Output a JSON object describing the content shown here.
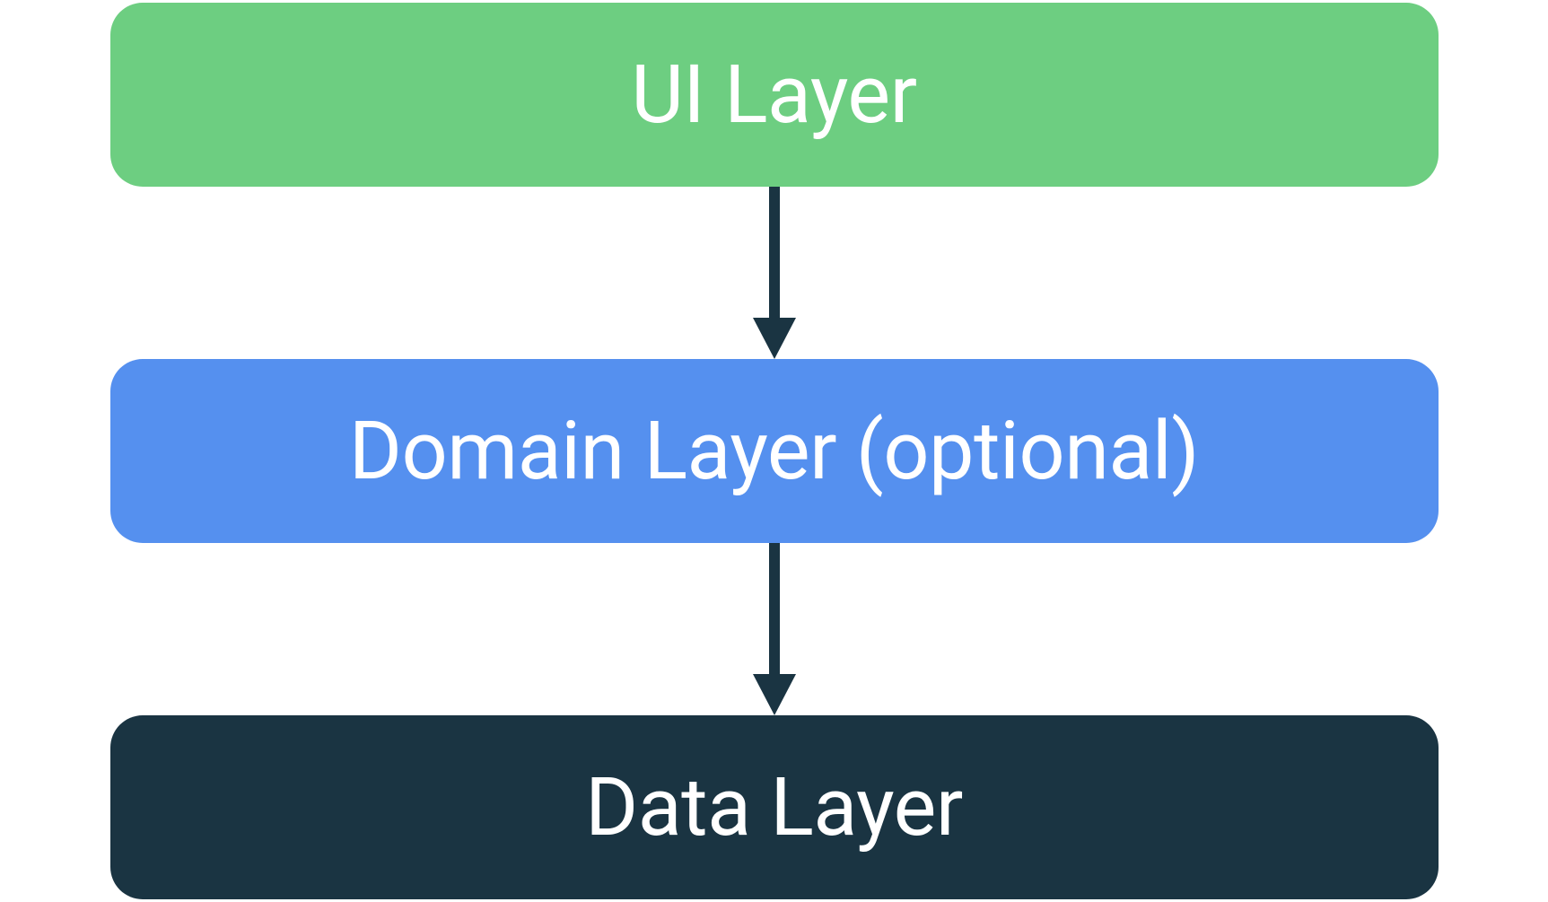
{
  "layers": {
    "ui": {
      "label": "UI Layer",
      "color": "#6dce81"
    },
    "domain": {
      "label": "Domain Layer (optional)",
      "color": "#5590ef"
    },
    "data": {
      "label": "Data Layer",
      "color": "#1a3442"
    }
  },
  "arrow_color": "#1a3442"
}
